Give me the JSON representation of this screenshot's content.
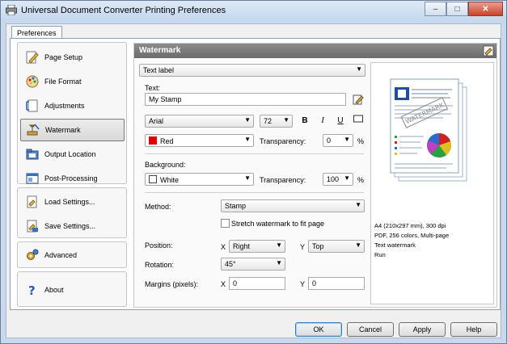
{
  "window": {
    "title": "Universal Document Converter Printing Preferences"
  },
  "tabs": {
    "preferences": "Preferences"
  },
  "sidebar": {
    "items": [
      {
        "label": "Page Setup"
      },
      {
        "label": "File Format"
      },
      {
        "label": "Adjustments"
      },
      {
        "label": "Watermark"
      },
      {
        "label": "Output Location"
      },
      {
        "label": "Post-Processing"
      },
      {
        "label": "Load Settings..."
      },
      {
        "label": "Save Settings..."
      },
      {
        "label": "Advanced"
      },
      {
        "label": "About"
      }
    ]
  },
  "panel": {
    "title": "Watermark",
    "type_select": "Text label",
    "text_label": "Text:",
    "text_value": "My Stamp",
    "font": "Arial",
    "font_size": "72",
    "bold": "B",
    "italic": "I",
    "underline": "U",
    "text_color": "Red",
    "transparency_label": "Transparency:",
    "text_transparency": "0",
    "percent": "%",
    "background_label": "Background:",
    "bg_color": "White",
    "bg_transparency": "100",
    "method_label": "Method:",
    "method": "Stamp",
    "stretch_label": "Stretch watermark to fit page",
    "position_label": "Position:",
    "x_label": "X",
    "y_label": "Y",
    "pos_x": "Right",
    "pos_y": "Top",
    "rotation_label": "Rotation:",
    "rotation": "45°",
    "margins_label": "Margins (pixels):",
    "margin_x": "0",
    "margin_y": "0"
  },
  "preview": {
    "stamp": "WATERMARK",
    "info": [
      "A4 (210x297 mm), 300 dpi",
      "PDF, 256 colors, Multi-page",
      "Text watermark",
      "Run"
    ]
  },
  "footer": {
    "ok": "OK",
    "cancel": "Cancel",
    "apply": "Apply",
    "help": "Help"
  },
  "colors": {
    "accent": "#3c7fb1",
    "header": "#7a7a7a",
    "red_swatch": "#e00000",
    "white_swatch": "#ffffff"
  }
}
